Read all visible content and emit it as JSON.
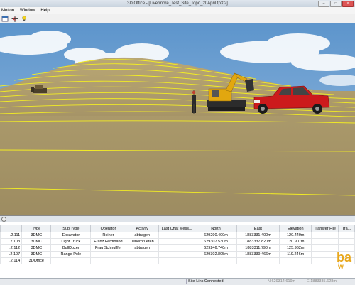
{
  "window": {
    "title": "3D Office - [Livermore_Test_Site_Topo_20April.tp3:2]"
  },
  "menu": {
    "items": [
      "Motion",
      "Window",
      "Help"
    ]
  },
  "toolbar": {
    "icons": [
      "layout-icon",
      "crosshair-icon",
      "lightbulb-icon"
    ]
  },
  "table": {
    "columns": [
      "",
      "Type",
      "Sub Type",
      "Operator",
      "Activity",
      "Last Chat Mess...",
      "North",
      "East",
      "Elevation",
      "Transfer File",
      "Tra..."
    ],
    "rows": [
      [
        ".2.111",
        "3DMC",
        "Excavator",
        "Reiner",
        "abtragen",
        "",
        "629290.400m",
        "1883331.400m",
        "120.449m",
        "",
        ""
      ],
      [
        ".2.103",
        "3DMC",
        "Light Truck",
        "Franz Ferdinand",
        "ueberpruefen",
        "",
        "629307.530m",
        "1883337.820m",
        "120.907m",
        "",
        ""
      ],
      [
        ".2.112",
        "3DMC",
        "BullDozer",
        "Frau Schnulffel",
        "abtragen",
        "",
        "629246.740m",
        "1883311.790m",
        "125.962m",
        "",
        ""
      ],
      [
        ".2.107",
        "3DMC",
        "Range Pole",
        "",
        "",
        "",
        "629302.805m",
        "1883339.466m",
        "119.246m",
        "",
        ""
      ],
      [
        ".2.114",
        "3DOffice",
        "",
        "",
        "",
        "",
        "",
        "",
        "",
        "",
        ""
      ]
    ]
  },
  "logo": {
    "text": "ba",
    "sub": "w"
  },
  "status": {
    "connection": "Site-Link Connected",
    "north": "N 629314.619m",
    "east": "E 1883385.628m"
  },
  "colors": {
    "sky": "#6fa2d2",
    "ground": "#b19f6e",
    "contour": "#f2ec24",
    "truck": "#cc1a1c",
    "excavator": "#e2a70f"
  }
}
